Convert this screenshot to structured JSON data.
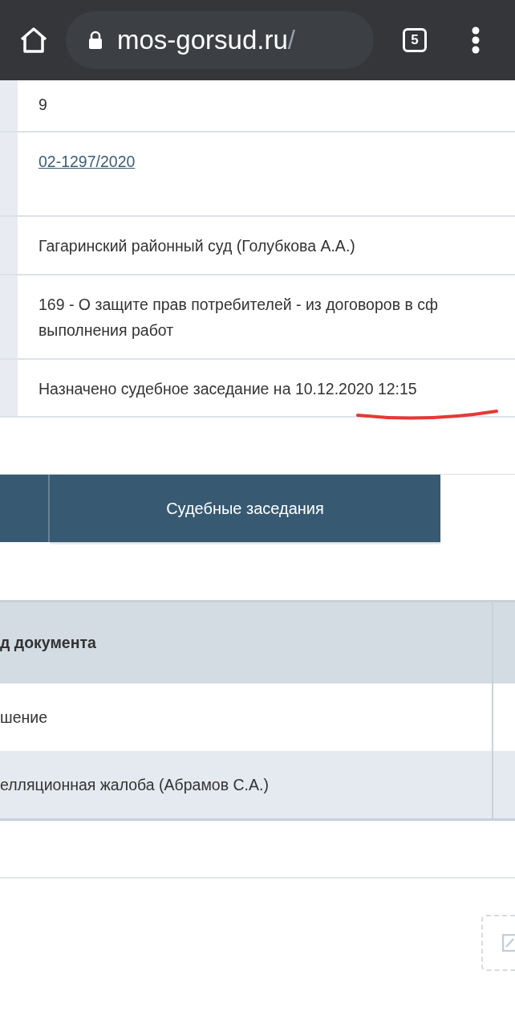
{
  "browser": {
    "url_host": "mos-gorsud.ru",
    "url_path": "/",
    "tab_count": "5"
  },
  "details": [
    {
      "kind": "text",
      "lines": [
        "9"
      ],
      "underlined": false
    },
    {
      "kind": "link",
      "lines": [
        "02-1297/2020"
      ],
      "underlined": false
    },
    {
      "kind": "text",
      "lines": [
        "Гагаринский районный суд (Голубкова А.А.)"
      ],
      "underlined": false
    },
    {
      "kind": "text",
      "lines": [
        "169 - О защите прав потребителей - из договоров в сф",
        "выполнения работ"
      ],
      "underlined": false
    },
    {
      "kind": "text",
      "lines": [
        "Назначено судебное заседание на 10.12.2020 12:15"
      ],
      "underlined": true
    }
  ],
  "tabs": [
    {
      "label": "Судебные заседания",
      "selected": false
    }
  ],
  "documents": {
    "columns": [
      "д документа"
    ],
    "rows": [
      [
        "шение"
      ],
      [
        "елляционная жалоба (Абрамов С.А.)"
      ]
    ]
  }
}
